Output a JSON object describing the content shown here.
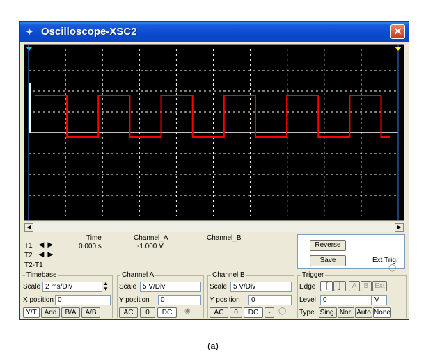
{
  "window": {
    "title": "Oscilloscope-XSC2",
    "close_label": "✕"
  },
  "measure": {
    "t1": "T1",
    "t2": "T2",
    "t2t1": "T2-T1",
    "time_header": "Time",
    "channel_a_header": "Channel_A",
    "channel_b_header": "Channel_B",
    "time_value": "0.000 s",
    "channel_a_value": "-1.000 V"
  },
  "buttons": {
    "reverse": "Reverse",
    "save": "Save",
    "ext_trig": "Ext Trig."
  },
  "timebase": {
    "title": "Timebase",
    "scale_label": "Scale",
    "scale_value": "2 ms/Div",
    "xpos_label": "X position",
    "xpos_value": "0",
    "modes": [
      "Y/T",
      "Add",
      "B/A",
      "A/B"
    ]
  },
  "channel_a": {
    "title": "Channel A",
    "scale_label": "Scale",
    "scale_value": "5  V/Div",
    "ypos_label": "Y position",
    "ypos_value": "0",
    "coupling": [
      "AC",
      "0",
      "DC"
    ]
  },
  "channel_b": {
    "title": "Channel B",
    "scale_label": "Scale",
    "scale_value": "5  V/Div",
    "ypos_label": "Y position",
    "ypos_value": "0",
    "coupling": [
      "AC",
      "0",
      "DC",
      "-"
    ]
  },
  "trigger": {
    "title": "Trigger",
    "edge_label": "Edge",
    "sources": [
      "A",
      "B",
      "Ext"
    ],
    "level_label": "Level",
    "level_value": "0",
    "level_unit": "V",
    "type_label": "Type",
    "types": [
      "Sing.",
      "Nor.",
      "Auto",
      "None"
    ]
  },
  "caption": "(a)",
  "colors": {
    "trace_a": "#ff0000",
    "grid": "#ffffff",
    "screen": "#000000",
    "cursor_t1": "#00c8ff",
    "cursor_t2": "#ffff00"
  },
  "waveform": {
    "high_div": 1.8,
    "low_div": -0.2,
    "period_ms": 3.4,
    "duty": 0.5,
    "first_rise_ms": 0.0
  }
}
